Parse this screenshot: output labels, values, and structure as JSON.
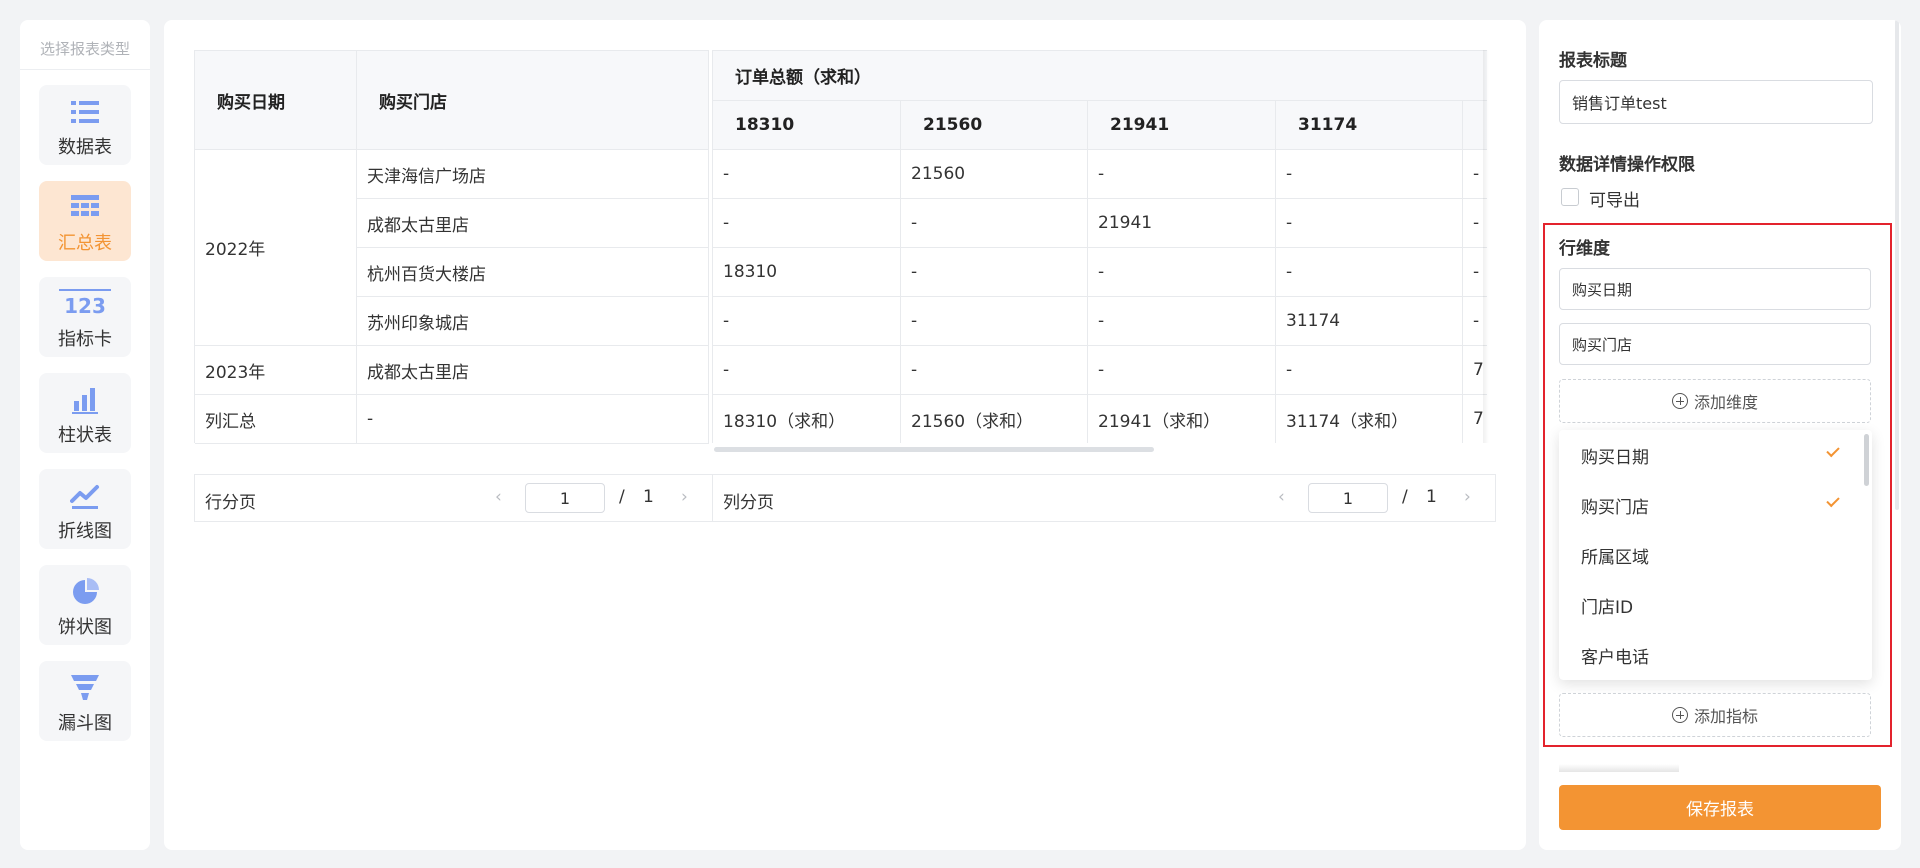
{
  "sidebar": {
    "title": "选择报表类型",
    "items": [
      {
        "label": "数据表",
        "icon": "list-icon"
      },
      {
        "label": "汇总表",
        "icon": "summary-table-icon",
        "active": true
      },
      {
        "label": "指标卡",
        "icon": "number-card-icon",
        "icon_text": "123"
      },
      {
        "label": "柱状表",
        "icon": "bar-chart-icon"
      },
      {
        "label": "折线图",
        "icon": "line-chart-icon"
      },
      {
        "label": "饼状图",
        "icon": "pie-chart-icon"
      },
      {
        "label": "漏斗图",
        "icon": "funnel-icon"
      }
    ]
  },
  "table": {
    "row_headers": [
      "购买日期",
      "购买门店"
    ],
    "measure_header": "订单总额（求和）",
    "columns": [
      "18310",
      "21560",
      "21941",
      "31174"
    ],
    "groups": [
      {
        "date": "2022年",
        "stores": [
          "天津海信广场店",
          "成都太古里店",
          "杭州百货大楼店",
          "苏州印象城店"
        ]
      },
      {
        "date": "2023年",
        "stores": [
          "成都太古里店"
        ]
      }
    ],
    "cells": [
      [
        "-",
        "21560",
        "-",
        "-",
        "-"
      ],
      [
        "-",
        "-",
        "21941",
        "-",
        "-"
      ],
      [
        "18310",
        "-",
        "-",
        "-",
        "-"
      ],
      [
        "-",
        "-",
        "-",
        "31174",
        "-"
      ],
      [
        "-",
        "-",
        "-",
        "-",
        "7"
      ]
    ],
    "total_row_label": "列汇总",
    "total_row_store": "-",
    "totals": [
      "18310（求和）",
      "21560（求和）",
      "21941（求和）",
      "31174（求和）",
      "7"
    ]
  },
  "row_pager": {
    "label": "行分页",
    "page": "1",
    "separator": "/",
    "total": "1"
  },
  "col_pager": {
    "label": "列分页",
    "page": "1",
    "separator": "/",
    "total": "1"
  },
  "config": {
    "title_label": "报表标题",
    "title_value": "销售订单test",
    "permission_label": "数据详情操作权限",
    "exportable_label": "可导出",
    "row_dim_label": "行维度",
    "row_dims": [
      "购买日期",
      "购买门店"
    ],
    "add_dim_label": "添加维度",
    "dropdown_options": [
      {
        "label": "购买日期",
        "checked": true
      },
      {
        "label": "购买门店",
        "checked": true
      },
      {
        "label": "所属区域",
        "checked": false
      },
      {
        "label": "门店ID",
        "checked": false
      },
      {
        "label": "客户电话",
        "checked": false
      }
    ],
    "add_metric_label": "添加指标",
    "save_label": "保存报表"
  },
  "colors": {
    "accent": "#f39433",
    "highlight": "#e3232d",
    "icon": "#7b9cf0"
  }
}
